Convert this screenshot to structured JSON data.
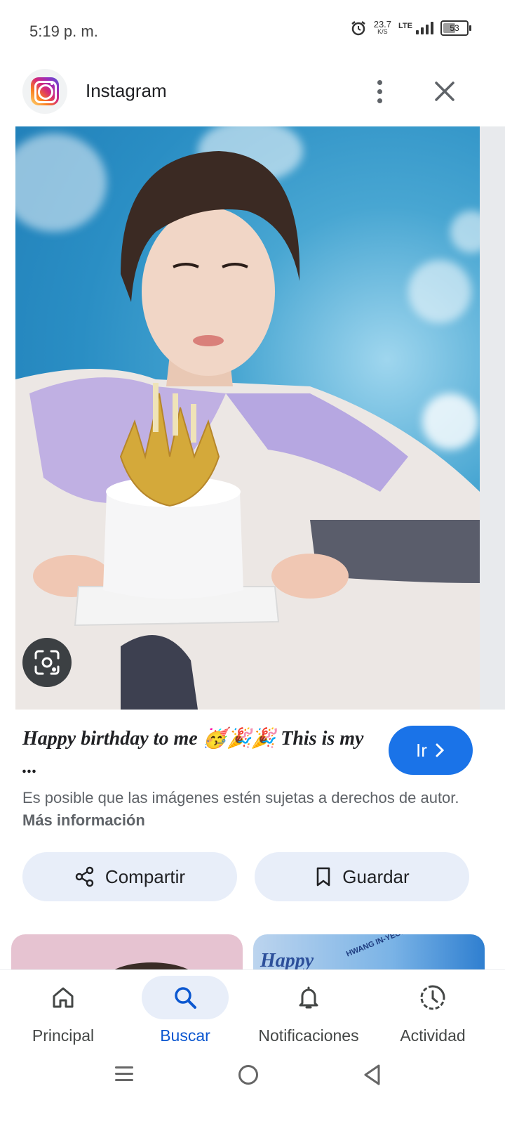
{
  "status_bar": {
    "time": "5:19 p. m.",
    "net_speed": "23.7",
    "net_unit": "K/S",
    "network": "LTE",
    "battery": "53",
    "battery_level": 0.53
  },
  "header": {
    "source_title": "Instagram",
    "logo_icon": "instagram-logo",
    "more_icon": "more-vert-icon",
    "close_icon": "close-icon"
  },
  "image": {
    "lens_icon": "lens-icon"
  },
  "result": {
    "title_line": "Happy birthday to me 🥳🎉🎉 This is my ...",
    "go_label": "Ir",
    "copyright_text": "Es posible que las imágenes estén sujetas a derechos de autor.",
    "more_info_link": "Más información"
  },
  "actions": {
    "share_label": "Compartir",
    "save_label": "Guardar"
  },
  "related": {
    "thumb2_text": "Happy",
    "thumb2_caption": "HWANG IN-YEOP"
  },
  "bottom_nav": {
    "items": [
      {
        "label": "Principal",
        "icon": "home-icon"
      },
      {
        "label": "Buscar",
        "icon": "search-icon",
        "active": true
      },
      {
        "label": "Notificaciones",
        "icon": "bell-icon"
      },
      {
        "label": "Actividad",
        "icon": "activity-icon"
      }
    ]
  },
  "colors": {
    "accent": "#1a73e8",
    "active_nav": "#0b57d0",
    "chip_bg": "#e8eef9"
  }
}
